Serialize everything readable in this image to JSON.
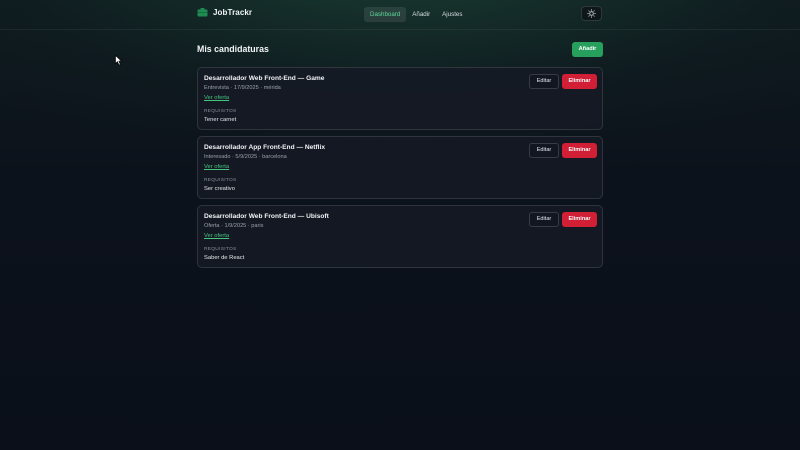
{
  "brand": {
    "name": "JobTrackr",
    "icon": "briefcase-icon",
    "accent": "#27a05e"
  },
  "nav": [
    {
      "label": "Dashboard",
      "active": true
    },
    {
      "label": "Añadir",
      "active": false
    },
    {
      "label": "Ajustes",
      "active": false
    }
  ],
  "theme_toggle": {
    "icon": "sun-icon"
  },
  "main": {
    "title": "Mis candidaturas",
    "add_label": "Añadir"
  },
  "applications": [
    {
      "title": "Desarrollador Web Front-End — Game",
      "meta": "Entrevista · 17/9/2025 · mérida",
      "link": "Ver oferta",
      "requirements_label": "REQUISITOS",
      "requirements": "Tener carnet",
      "edit_label": "Editar",
      "delete_label": "Eliminar"
    },
    {
      "title": "Desarrollador App Front-End — Netflix",
      "meta": "Interesado · 5/9/2025 · barcelona",
      "link": "Ver oferta",
      "requirements_label": "REQUISITOS",
      "requirements": "Ser creativo",
      "edit_label": "Editar",
      "delete_label": "Eliminar"
    },
    {
      "title": "Desarrollador Web Front-End — Ubisoft",
      "meta": "Oferta · 1/9/2025 · paris",
      "link": "Ver oferta",
      "requirements_label": "REQUISITOS",
      "requirements": "Saber de React",
      "edit_label": "Editar",
      "delete_label": "Eliminar"
    }
  ],
  "colors": {
    "danger": "#d11f35",
    "success": "#27a05e",
    "link": "#46c57f"
  }
}
